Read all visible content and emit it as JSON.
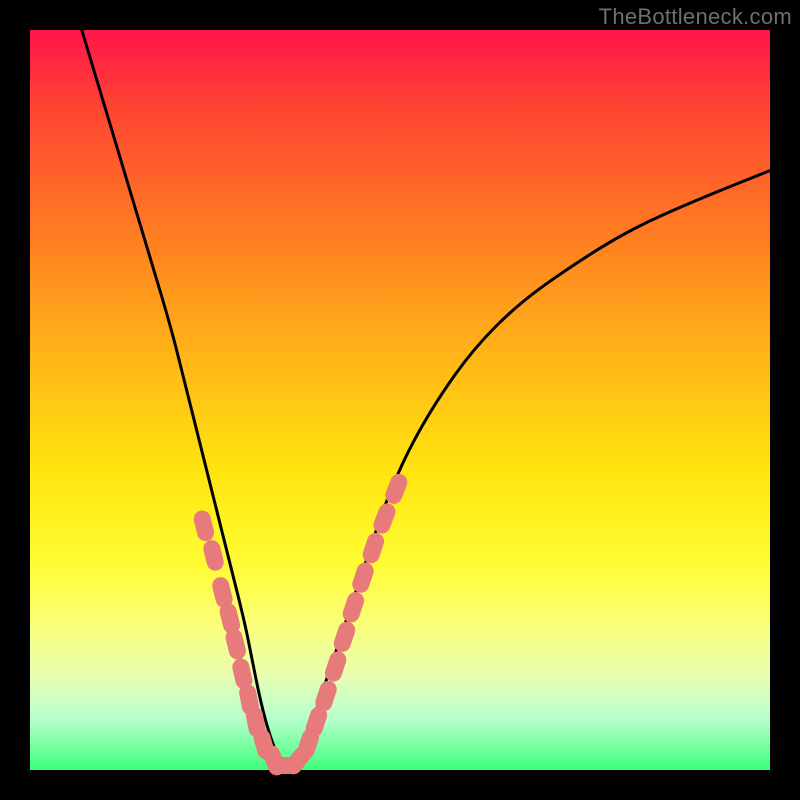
{
  "watermark": "TheBottleneck.com",
  "colors": {
    "curve_stroke": "#000000",
    "marker_fill": "#e77a7a",
    "marker_stroke": "#e77a7a"
  },
  "chart_data": {
    "type": "line",
    "title": "",
    "xlabel": "",
    "ylabel": "",
    "xlim": [
      0,
      100
    ],
    "ylim": [
      0,
      100
    ],
    "curves": [
      {
        "name": "main-v-curve",
        "x": [
          7,
          10,
          13,
          16,
          19,
          21,
          23,
          25,
          27,
          29,
          30,
          31,
          32,
          33,
          34,
          35,
          36,
          37,
          38,
          40,
          42,
          44,
          46,
          48,
          51,
          55,
          60,
          66,
          73,
          81,
          90,
          100
        ],
        "y": [
          100,
          90,
          80,
          70,
          60,
          52,
          44,
          36,
          28,
          20,
          15,
          10,
          6,
          3,
          1,
          0.5,
          1,
          3,
          6,
          12,
          18,
          24,
          30,
          36,
          43,
          50,
          57,
          63,
          68,
          73,
          77,
          81
        ]
      }
    ],
    "markers": [
      {
        "x": 23.5,
        "y": 33
      },
      {
        "x": 24.8,
        "y": 29
      },
      {
        "x": 26.0,
        "y": 24
      },
      {
        "x": 27.0,
        "y": 20.5
      },
      {
        "x": 27.8,
        "y": 17
      },
      {
        "x": 28.7,
        "y": 13
      },
      {
        "x": 29.6,
        "y": 9.5
      },
      {
        "x": 30.5,
        "y": 6.5
      },
      {
        "x": 31.6,
        "y": 3.5
      },
      {
        "x": 33.0,
        "y": 1.3
      },
      {
        "x": 34.6,
        "y": 0.6
      },
      {
        "x": 36.2,
        "y": 1.3
      },
      {
        "x": 37.6,
        "y": 3.5
      },
      {
        "x": 38.7,
        "y": 6.5
      },
      {
        "x": 40.0,
        "y": 10
      },
      {
        "x": 41.3,
        "y": 14
      },
      {
        "x": 42.5,
        "y": 18
      },
      {
        "x": 43.7,
        "y": 22
      },
      {
        "x": 45.0,
        "y": 26
      },
      {
        "x": 46.4,
        "y": 30
      },
      {
        "x": 47.9,
        "y": 34
      },
      {
        "x": 49.5,
        "y": 38
      }
    ]
  }
}
